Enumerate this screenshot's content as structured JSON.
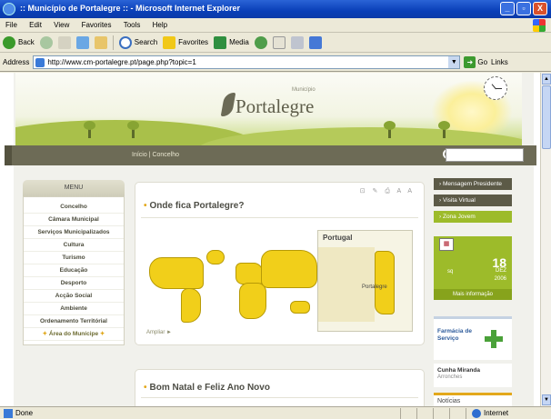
{
  "window": {
    "title": ":: Município de Portalegre :: - Microsoft Internet Explorer",
    "buttons": [
      "_",
      "▫",
      "X"
    ]
  },
  "menubar": [
    "File",
    "Edit",
    "View",
    "Favorites",
    "Tools",
    "Help"
  ],
  "toolbar": {
    "back": "Back",
    "search": "Search",
    "favorites": "Favorites",
    "media": "Media"
  },
  "addressbar": {
    "label": "Address",
    "url": "http://www.cm-portalegre.pt/page.php?topic=1",
    "go": "Go",
    "links": "Links"
  },
  "status": {
    "text": "Done",
    "zone": "Internet"
  },
  "site": {
    "logo_text": "Portalegre",
    "logo_sub": "Município",
    "nav_links": "Início | Concelho",
    "menu_title": "MENU",
    "menu_items": [
      "Concelho",
      "Câmara Municipal",
      "Serviços Municipalizados",
      "Cultura",
      "Turismo",
      "Educação",
      "Desporto",
      "Acção Social",
      "Ambiente",
      "Ordenamento Territórial",
      "Área do Munícipe"
    ],
    "panel1": {
      "icons": "⊡ ✎ ⎙ A A",
      "title": "Onde fica Portalegre?",
      "inset_title": "Portugal",
      "inset_city": "Portalegre",
      "map_link": "Ampliar ►"
    },
    "panel2": {
      "title": "Bom Natal e Feliz Ano Novo"
    },
    "right": {
      "btn1": "› Mensagem Presidente",
      "btn2": "› Visita Virtual",
      "btn3": "› Zona Jovem",
      "cal_day": "18",
      "cal_weekday": "sq",
      "cal_month": "DEZ",
      "cal_year": "2006",
      "cal_more": "Mais informação",
      "box1_title": "Farmácia de Serviço",
      "box2_name": "Cunha Miranda",
      "box2_sub": "Arronches",
      "box3_title": "Notícias"
    }
  }
}
